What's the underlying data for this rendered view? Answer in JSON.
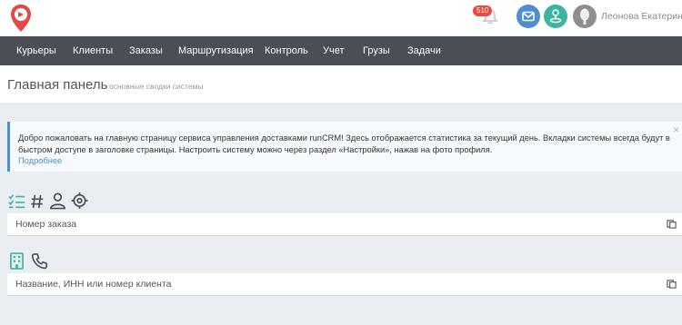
{
  "header": {
    "notifications_count": "510",
    "user_name": "Леонова Екатерина",
    "icons": [
      "logo-pin-icon",
      "bell-icon",
      "mail-icon",
      "map-marker-icon",
      "user-avatar-icon"
    ]
  },
  "nav": {
    "items": [
      {
        "label": "Курьеры"
      },
      {
        "label": "Клиенты"
      },
      {
        "label": "Заказы"
      },
      {
        "label": "Маршрутизация"
      },
      {
        "label": "Контроль"
      },
      {
        "label": "Учет"
      },
      {
        "label": "Грузы"
      },
      {
        "label": "Задачи"
      }
    ]
  },
  "page": {
    "title": "Главная панель",
    "subtitle": "основные сводки системы"
  },
  "alert": {
    "text": "Добро пожаловать на главную страницу сервиса управления доставками runCRM! Здесь отображается статистика за текущий день. Вкладки системы всегда будут в быстром доступе в заголовке страницы. Настроить систему можно через раздел «Настройки», нажав на фото профиля.",
    "link": "Подробнее",
    "close": "×"
  },
  "order_search": {
    "icons": [
      "checklist-icon",
      "hash-icon",
      "person-icon",
      "target-icon"
    ],
    "placeholder": "Номер заказа"
  },
  "client_search": {
    "icons": [
      "building-icon",
      "phone-icon"
    ],
    "placeholder": "Название, ИНН или номер клиента"
  },
  "colors": {
    "nav_bg": "#4a4f57",
    "accent_blue": "#4e8fd1",
    "accent_teal": "#3bb5a2",
    "badge_red": "#e74c3c",
    "page_bg": "#eaedf2"
  }
}
